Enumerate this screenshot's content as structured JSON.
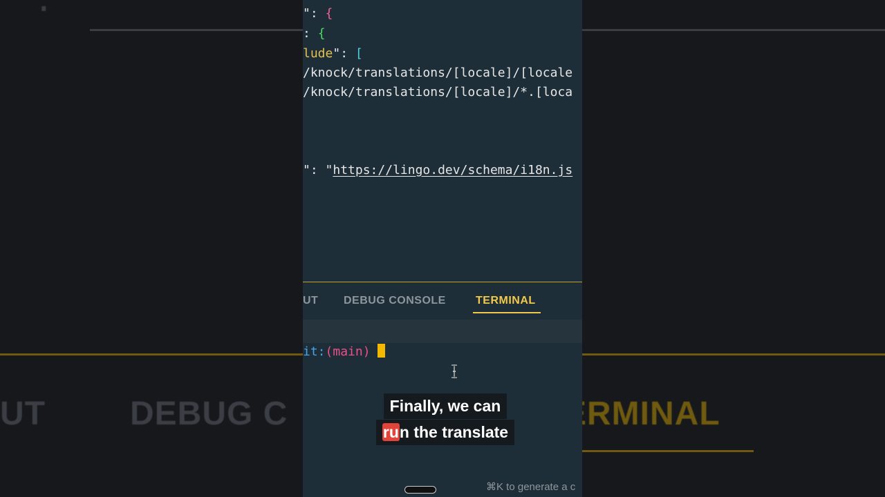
{
  "background": {
    "top_left_text": "\":",
    "top_right_text": "https://lingo.dev/schema/i18n.js",
    "tab_left": "UT",
    "tab_middle": "DEBUG C",
    "tab_right": "ERMINAL"
  },
  "editor": {
    "lines": [
      {
        "parts": [
          "\"",
          ": ",
          "{"
        ]
      },
      {
        "parts": [
          ":",
          " ",
          "{"
        ]
      },
      {
        "parts": [
          "lude",
          "\": ",
          "["
        ]
      },
      {
        "text": "/knock/translations/[locale]/[locale"
      },
      {
        "text": "/knock/translations/[locale]/*.[loca"
      },
      {
        "parts": [
          "\"",
          ": ",
          "\"",
          "https://lingo.dev/schema/i18n.js"
        ]
      }
    ]
  },
  "panel_tabs": {
    "output": "UT",
    "debug_console": "DEBUG CONSOLE",
    "terminal": "TERMINAL"
  },
  "terminal": {
    "prompt_git": "it:",
    "prompt_branch": "(main)"
  },
  "caption": {
    "line1": "Finally, we can",
    "line2_highlight": "ru",
    "line2_rest": "n the translate"
  },
  "hint": "⌘K to generate a c",
  "colors": {
    "panel_bg": "#1e2e38",
    "accent": "#f2c94c",
    "caption_highlight": "#e0443a"
  }
}
